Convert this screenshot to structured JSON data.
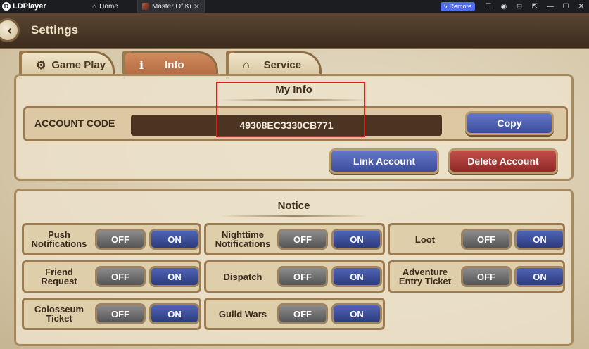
{
  "emulator": {
    "brand": "LDPlayer",
    "tabs": [
      {
        "label": "Home"
      },
      {
        "label": "Master Of Kn..."
      }
    ],
    "remote_label": "Remote"
  },
  "header": {
    "title": "Settings"
  },
  "tabs": [
    {
      "label": "Game Play",
      "icon": "gear-icon"
    },
    {
      "label": "Info",
      "icon": "info-icon",
      "active": true
    },
    {
      "label": "Service",
      "icon": "house-icon"
    }
  ],
  "my_info": {
    "title": "My Info",
    "account_label": "ACCOUNT CODE",
    "account_code": "49308EC3330CB771",
    "copy_label": "Copy",
    "link_label": "Link Account",
    "delete_label": "Delete Account"
  },
  "notice": {
    "title": "Notice",
    "off_label": "OFF",
    "on_label": "ON",
    "items": [
      {
        "line1": "Push",
        "line2": "Notifications"
      },
      {
        "line1": "Nighttime",
        "line2": "Notifications"
      },
      {
        "line1": "Loot",
        "line2": ""
      },
      {
        "line1": "Friend",
        "line2": "Request"
      },
      {
        "line1": "Dispatch",
        "line2": ""
      },
      {
        "line1": "Adventure",
        "line2": "Entry Ticket"
      },
      {
        "line1": "Colosseum",
        "line2": "Ticket"
      },
      {
        "line1": "Guild Wars",
        "line2": ""
      }
    ]
  },
  "colors": {
    "on_blue": "#3c4d99",
    "delete_red": "#8f2a28",
    "highlight": "#e41c1c"
  }
}
